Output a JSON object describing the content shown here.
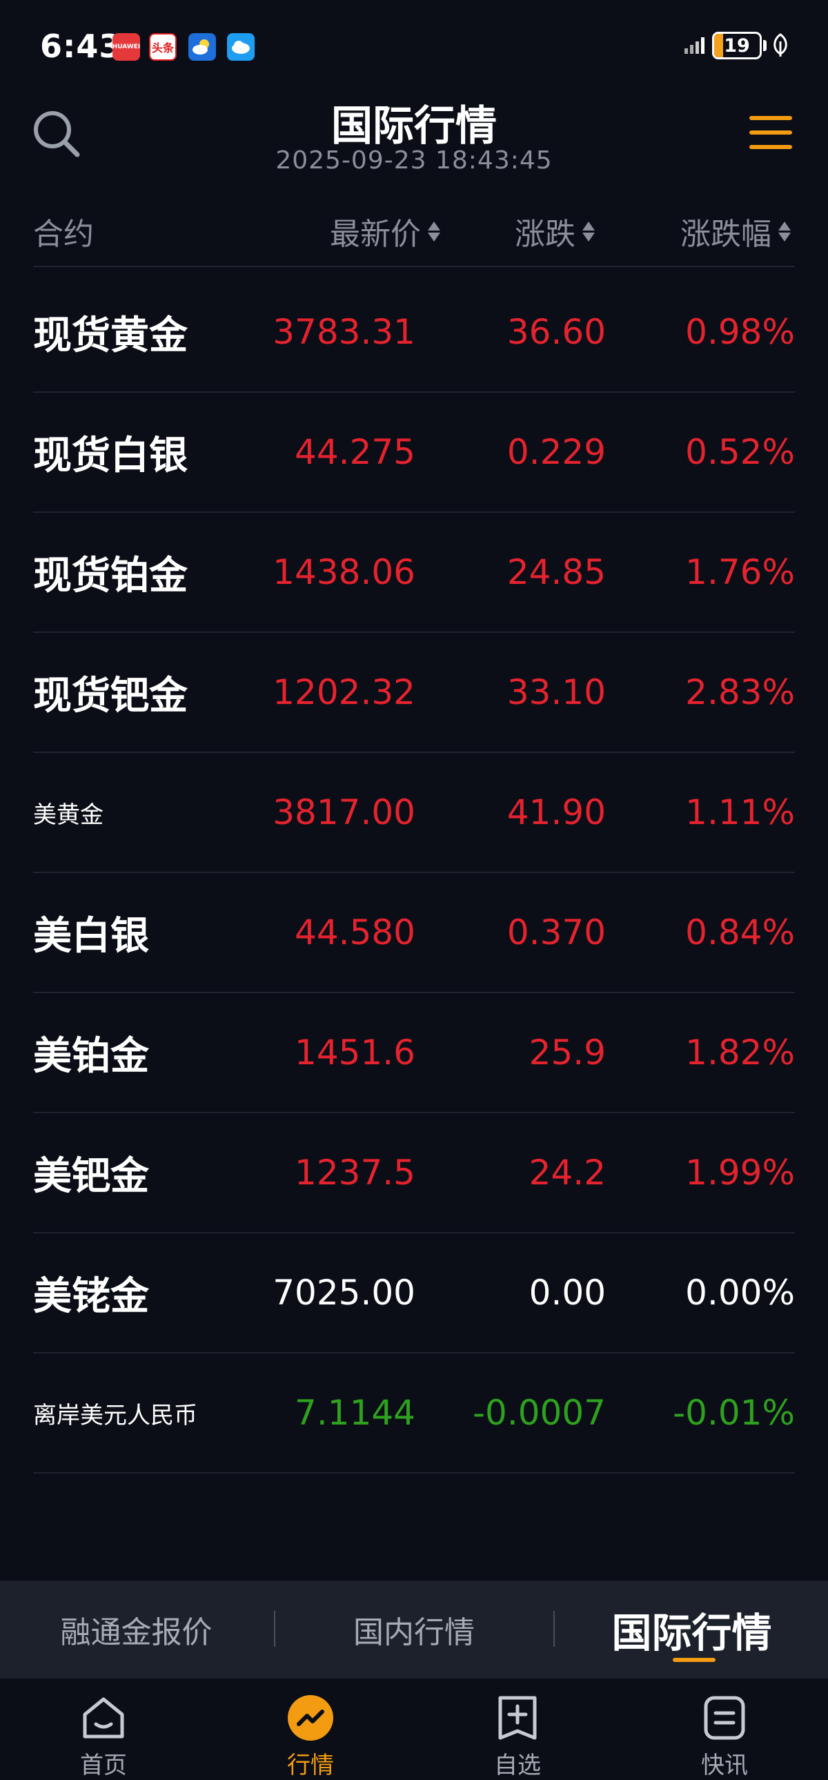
{
  "status_bar": {
    "time": "6:43",
    "battery_level": "19",
    "notification_icons": [
      "huawei-app-icon",
      "toutiao-app-icon",
      "weather-app-icon",
      "cloud-app-icon"
    ],
    "notif_labels": [
      "HUAWEI",
      "头条",
      "",
      ""
    ]
  },
  "header": {
    "title": "国际行情",
    "timestamp": "2025-09-23 18:43:45"
  },
  "columns": {
    "name": "合约",
    "price": "最新价",
    "change": "涨跌",
    "change_pct": "涨跌幅"
  },
  "rows": [
    {
      "name": "现货黄金",
      "price": "3783.31",
      "change": "36.60",
      "change_pct": "0.98%",
      "trend": "up",
      "size": "large"
    },
    {
      "name": "现货白银",
      "price": "44.275",
      "change": "0.229",
      "change_pct": "0.52%",
      "trend": "up",
      "size": "large"
    },
    {
      "name": "现货铂金",
      "price": "1438.06",
      "change": "24.85",
      "change_pct": "1.76%",
      "trend": "up",
      "size": "large"
    },
    {
      "name": "现货钯金",
      "price": "1202.32",
      "change": "33.10",
      "change_pct": "2.83%",
      "trend": "up",
      "size": "large"
    },
    {
      "name": "美黄金",
      "price": "3817.00",
      "change": "41.90",
      "change_pct": "1.11%",
      "trend": "up",
      "size": "small"
    },
    {
      "name": "美白银",
      "price": "44.580",
      "change": "0.370",
      "change_pct": "0.84%",
      "trend": "up",
      "size": "large"
    },
    {
      "name": "美铂金",
      "price": "1451.6",
      "change": "25.9",
      "change_pct": "1.82%",
      "trend": "up",
      "size": "large"
    },
    {
      "name": "美钯金",
      "price": "1237.5",
      "change": "24.2",
      "change_pct": "1.99%",
      "trend": "up",
      "size": "large"
    },
    {
      "name": "美铑金",
      "price": "7025.00",
      "change": "0.00",
      "change_pct": "0.00%",
      "trend": "flat",
      "size": "large"
    },
    {
      "name": "离岸美元人民币",
      "price": "7.1144",
      "change": "-0.0007",
      "change_pct": "-0.01%",
      "trend": "down",
      "size": "small"
    }
  ],
  "tabs": {
    "t1": "融通金报价",
    "t2": "国内行情",
    "t3": "国际行情",
    "active": "t3"
  },
  "bottom_nav": {
    "home": "首页",
    "market": "行情",
    "watchlist": "自选",
    "news": "快讯",
    "active": "market"
  },
  "colors": {
    "up": "#e5232e",
    "down": "#2ea11f",
    "flat": "#ffffff",
    "accent": "#f39c12",
    "background": "#0b0e17"
  }
}
